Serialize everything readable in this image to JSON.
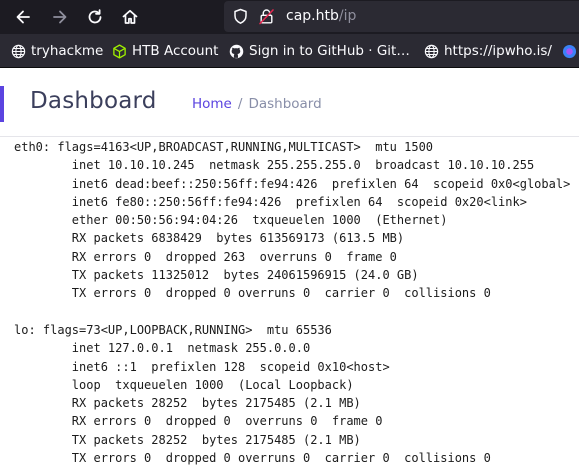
{
  "browser": {
    "url": {
      "host": "cap.htb",
      "path": "/ip"
    },
    "bookmarks": [
      {
        "label": "tryhackme",
        "icon": "globe-icon"
      },
      {
        "label": "HTB Account",
        "icon": "htb-cube-icon"
      },
      {
        "label": "Sign in to GitHub · Git…",
        "icon": "github-icon"
      },
      {
        "label": "https://ipwho.is/",
        "icon": "globe-icon"
      }
    ]
  },
  "header": {
    "title": "Dashboard",
    "breadcrumb": {
      "home": "Home",
      "separator": "/",
      "current": "Dashboard"
    }
  },
  "output": {
    "lines": [
      "eth0: flags=4163<UP,BROADCAST,RUNNING,MULTICAST>  mtu 1500",
      "        inet 10.10.10.245  netmask 255.255.255.0  broadcast 10.10.10.255",
      "        inet6 dead:beef::250:56ff:fe94:426  prefixlen 64  scopeid 0x0<global>",
      "        inet6 fe80::250:56ff:fe94:426  prefixlen 64  scopeid 0x20<link>",
      "        ether 00:50:56:94:04:26  txqueuelen 1000  (Ethernet)",
      "        RX packets 6838429  bytes 613569173 (613.5 MB)",
      "        RX errors 0  dropped 263  overruns 0  frame 0",
      "        TX packets 11325012  bytes 24061596915 (24.0 GB)",
      "        TX errors 0  dropped 0 overruns 0  carrier 0  collisions 0",
      "",
      "lo: flags=73<UP,LOOPBACK,RUNNING>  mtu 65536",
      "        inet 127.0.0.1  netmask 255.0.0.0",
      "        inet6 ::1  prefixlen 128  scopeid 0x10<host>",
      "        loop  txqueuelen 1000  (Local Loopback)",
      "        RX packets 28252  bytes 2175485 (2.1 MB)",
      "        RX errors 0  dropped 0  overruns 0  frame 0",
      "        TX packets 28252  bytes 2175485 (2.1 MB)",
      "        TX errors 0  dropped 0 overruns 0  carrier 0  collisions 0"
    ]
  },
  "colors": {
    "accent": "#5b44e0",
    "chrome_dark": "#1c1b22",
    "chrome_bar": "#2b2a33",
    "lock_warning": "#e22850"
  }
}
